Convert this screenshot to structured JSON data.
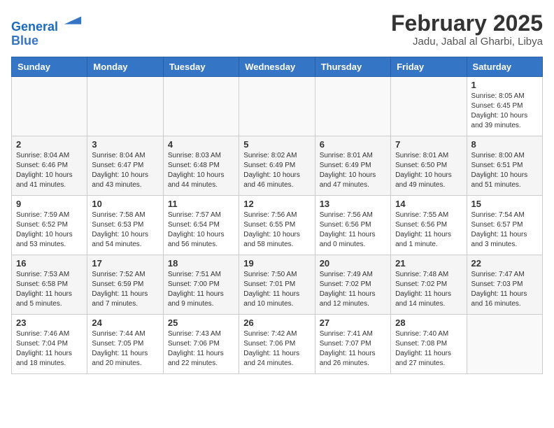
{
  "header": {
    "logo_line1": "General",
    "logo_line2": "Blue",
    "month_title": "February 2025",
    "location": "Jadu, Jabal al Gharbi, Libya"
  },
  "days_of_week": [
    "Sunday",
    "Monday",
    "Tuesday",
    "Wednesday",
    "Thursday",
    "Friday",
    "Saturday"
  ],
  "weeks": [
    [
      {
        "day": "",
        "info": ""
      },
      {
        "day": "",
        "info": ""
      },
      {
        "day": "",
        "info": ""
      },
      {
        "day": "",
        "info": ""
      },
      {
        "day": "",
        "info": ""
      },
      {
        "day": "",
        "info": ""
      },
      {
        "day": "1",
        "info": "Sunrise: 8:05 AM\nSunset: 6:45 PM\nDaylight: 10 hours\nand 39 minutes."
      }
    ],
    [
      {
        "day": "2",
        "info": "Sunrise: 8:04 AM\nSunset: 6:46 PM\nDaylight: 10 hours\nand 41 minutes."
      },
      {
        "day": "3",
        "info": "Sunrise: 8:04 AM\nSunset: 6:47 PM\nDaylight: 10 hours\nand 43 minutes."
      },
      {
        "day": "4",
        "info": "Sunrise: 8:03 AM\nSunset: 6:48 PM\nDaylight: 10 hours\nand 44 minutes."
      },
      {
        "day": "5",
        "info": "Sunrise: 8:02 AM\nSunset: 6:49 PM\nDaylight: 10 hours\nand 46 minutes."
      },
      {
        "day": "6",
        "info": "Sunrise: 8:01 AM\nSunset: 6:49 PM\nDaylight: 10 hours\nand 47 minutes."
      },
      {
        "day": "7",
        "info": "Sunrise: 8:01 AM\nSunset: 6:50 PM\nDaylight: 10 hours\nand 49 minutes."
      },
      {
        "day": "8",
        "info": "Sunrise: 8:00 AM\nSunset: 6:51 PM\nDaylight: 10 hours\nand 51 minutes."
      }
    ],
    [
      {
        "day": "9",
        "info": "Sunrise: 7:59 AM\nSunset: 6:52 PM\nDaylight: 10 hours\nand 53 minutes."
      },
      {
        "day": "10",
        "info": "Sunrise: 7:58 AM\nSunset: 6:53 PM\nDaylight: 10 hours\nand 54 minutes."
      },
      {
        "day": "11",
        "info": "Sunrise: 7:57 AM\nSunset: 6:54 PM\nDaylight: 10 hours\nand 56 minutes."
      },
      {
        "day": "12",
        "info": "Sunrise: 7:56 AM\nSunset: 6:55 PM\nDaylight: 10 hours\nand 58 minutes."
      },
      {
        "day": "13",
        "info": "Sunrise: 7:56 AM\nSunset: 6:56 PM\nDaylight: 11 hours\nand 0 minutes."
      },
      {
        "day": "14",
        "info": "Sunrise: 7:55 AM\nSunset: 6:56 PM\nDaylight: 11 hours\nand 1 minute."
      },
      {
        "day": "15",
        "info": "Sunrise: 7:54 AM\nSunset: 6:57 PM\nDaylight: 11 hours\nand 3 minutes."
      }
    ],
    [
      {
        "day": "16",
        "info": "Sunrise: 7:53 AM\nSunset: 6:58 PM\nDaylight: 11 hours\nand 5 minutes."
      },
      {
        "day": "17",
        "info": "Sunrise: 7:52 AM\nSunset: 6:59 PM\nDaylight: 11 hours\nand 7 minutes."
      },
      {
        "day": "18",
        "info": "Sunrise: 7:51 AM\nSunset: 7:00 PM\nDaylight: 11 hours\nand 9 minutes."
      },
      {
        "day": "19",
        "info": "Sunrise: 7:50 AM\nSunset: 7:01 PM\nDaylight: 11 hours\nand 10 minutes."
      },
      {
        "day": "20",
        "info": "Sunrise: 7:49 AM\nSunset: 7:02 PM\nDaylight: 11 hours\nand 12 minutes."
      },
      {
        "day": "21",
        "info": "Sunrise: 7:48 AM\nSunset: 7:02 PM\nDaylight: 11 hours\nand 14 minutes."
      },
      {
        "day": "22",
        "info": "Sunrise: 7:47 AM\nSunset: 7:03 PM\nDaylight: 11 hours\nand 16 minutes."
      }
    ],
    [
      {
        "day": "23",
        "info": "Sunrise: 7:46 AM\nSunset: 7:04 PM\nDaylight: 11 hours\nand 18 minutes."
      },
      {
        "day": "24",
        "info": "Sunrise: 7:44 AM\nSunset: 7:05 PM\nDaylight: 11 hours\nand 20 minutes."
      },
      {
        "day": "25",
        "info": "Sunrise: 7:43 AM\nSunset: 7:06 PM\nDaylight: 11 hours\nand 22 minutes."
      },
      {
        "day": "26",
        "info": "Sunrise: 7:42 AM\nSunset: 7:06 PM\nDaylight: 11 hours\nand 24 minutes."
      },
      {
        "day": "27",
        "info": "Sunrise: 7:41 AM\nSunset: 7:07 PM\nDaylight: 11 hours\nand 26 minutes."
      },
      {
        "day": "28",
        "info": "Sunrise: 7:40 AM\nSunset: 7:08 PM\nDaylight: 11 hours\nand 27 minutes."
      },
      {
        "day": "",
        "info": ""
      }
    ]
  ]
}
